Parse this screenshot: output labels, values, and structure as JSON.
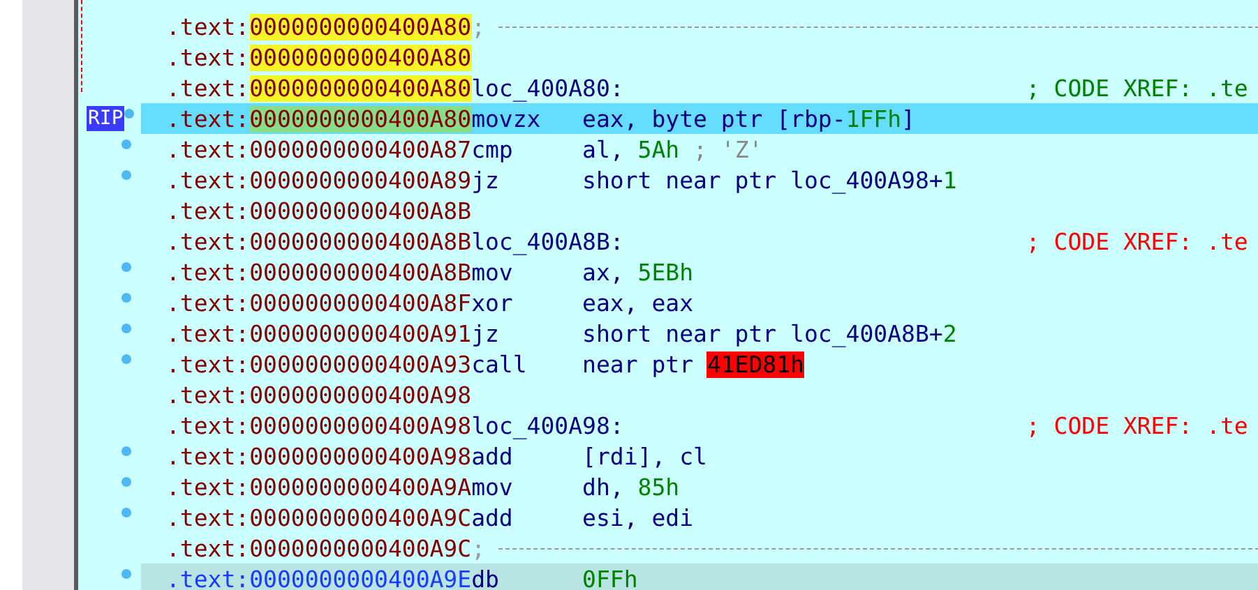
{
  "rows": [
    {
      "kind": "separator",
      "prefix": ".text:",
      "address": "0000000000400A80",
      "highlighted": true,
      "current": false,
      "selected": false,
      "dot": false,
      "text": ";"
    },
    {
      "kind": "blank",
      "prefix": ".text:",
      "address": "0000000000400A80",
      "highlighted": true,
      "current": false,
      "selected": false,
      "dot": false
    },
    {
      "kind": "label",
      "prefix": ".text:",
      "address": "0000000000400A80",
      "highlighted": true,
      "current": false,
      "selected": false,
      "dot": false,
      "label": "loc_400A80:",
      "comment": "; CODE XREF: .te",
      "color": "#008000"
    },
    {
      "kind": "instr",
      "prefix": ".text:",
      "address": "0000000000400A80",
      "highlighted": false,
      "current": true,
      "selected": false,
      "dot": true,
      "badge": "RIP",
      "mnemonic": "movzx",
      "operands": [
        {
          "t": "eax, byte ptr [rbp-",
          "kind": "plain"
        },
        {
          "t": "1FFh",
          "kind": "num"
        },
        {
          "t": "]",
          "kind": "plain"
        }
      ]
    },
    {
      "kind": "instr",
      "prefix": ".text:",
      "address": "0000000000400A87",
      "highlighted": false,
      "current": false,
      "selected": false,
      "dot": true,
      "mnemonic": "cmp",
      "operands": [
        {
          "t": "al, ",
          "kind": "plain"
        },
        {
          "t": "5Ah",
          "kind": "num"
        },
        {
          "t": " ; 'Z'",
          "kind": "comment"
        }
      ]
    },
    {
      "kind": "instr",
      "prefix": ".text:",
      "address": "0000000000400A89",
      "highlighted": false,
      "current": false,
      "selected": false,
      "dot": true,
      "mnemonic": "jz",
      "operands": [
        {
          "t": "short near ptr loc_400A98+",
          "kind": "plain"
        },
        {
          "t": "1",
          "kind": "num"
        }
      ]
    },
    {
      "kind": "blank",
      "prefix": ".text:",
      "address": "0000000000400A8B",
      "highlighted": false,
      "current": false,
      "selected": false,
      "dot": false
    },
    {
      "kind": "label",
      "prefix": ".text:",
      "address": "0000000000400A8B",
      "highlighted": false,
      "current": false,
      "selected": false,
      "dot": false,
      "label": "loc_400A8B:",
      "comment": "; CODE XREF: .te",
      "color": "#ff0000"
    },
    {
      "kind": "instr",
      "prefix": ".text:",
      "address": "0000000000400A8B",
      "highlighted": false,
      "current": false,
      "selected": false,
      "dot": true,
      "mnemonic": "mov",
      "operands": [
        {
          "t": "ax, ",
          "kind": "plain"
        },
        {
          "t": "5EBh",
          "kind": "num"
        }
      ]
    },
    {
      "kind": "instr",
      "prefix": ".text:",
      "address": "0000000000400A8F",
      "highlighted": false,
      "current": false,
      "selected": false,
      "dot": true,
      "mnemonic": "xor",
      "operands": [
        {
          "t": "eax, eax",
          "kind": "plain"
        }
      ]
    },
    {
      "kind": "instr",
      "prefix": ".text:",
      "address": "0000000000400A91",
      "highlighted": false,
      "current": false,
      "selected": false,
      "dot": true,
      "mnemonic": "jz",
      "operands": [
        {
          "t": "short near ptr loc_400A8B+",
          "kind": "plain"
        },
        {
          "t": "2",
          "kind": "num"
        }
      ]
    },
    {
      "kind": "instr",
      "prefix": ".text:",
      "address": "0000000000400A93",
      "highlighted": false,
      "current": false,
      "selected": false,
      "dot": true,
      "mnemonic": "call",
      "operands": [
        {
          "t": "near ptr ",
          "kind": "plain"
        },
        {
          "t": "41ED81h",
          "kind": "error"
        }
      ]
    },
    {
      "kind": "blank",
      "prefix": ".text:",
      "address": "0000000000400A98",
      "highlighted": false,
      "current": false,
      "selected": false,
      "dot": false
    },
    {
      "kind": "label",
      "prefix": ".text:",
      "address": "0000000000400A98",
      "highlighted": false,
      "current": false,
      "selected": false,
      "dot": false,
      "label": "loc_400A98:",
      "comment": "; CODE XREF: .te",
      "color": "#ff0000"
    },
    {
      "kind": "instr",
      "prefix": ".text:",
      "address": "0000000000400A98",
      "highlighted": false,
      "current": false,
      "selected": false,
      "dot": true,
      "mnemonic": "add",
      "operands": [
        {
          "t": "[rdi], cl",
          "kind": "plain"
        }
      ]
    },
    {
      "kind": "instr",
      "prefix": ".text:",
      "address": "0000000000400A9A",
      "highlighted": false,
      "current": false,
      "selected": false,
      "dot": true,
      "mnemonic": "mov",
      "operands": [
        {
          "t": "dh, ",
          "kind": "plain"
        },
        {
          "t": "85h",
          "kind": "num"
        }
      ]
    },
    {
      "kind": "instr",
      "prefix": ".text:",
      "address": "0000000000400A9C",
      "highlighted": false,
      "current": false,
      "selected": false,
      "dot": true,
      "mnemonic": "add",
      "operands": [
        {
          "t": "esi, edi",
          "kind": "plain"
        }
      ]
    },
    {
      "kind": "separator",
      "prefix": ".text:",
      "address": "0000000000400A9C",
      "highlighted": false,
      "current": false,
      "selected": false,
      "dot": false,
      "text": ";"
    },
    {
      "kind": "instr",
      "prefix": ".text:",
      "address": "0000000000400A9E",
      "highlighted": false,
      "current": false,
      "selected": true,
      "dot": true,
      "mnemonic": "db",
      "operands": [
        {
          "t": "0FFh",
          "kind": "num"
        }
      ]
    }
  ]
}
